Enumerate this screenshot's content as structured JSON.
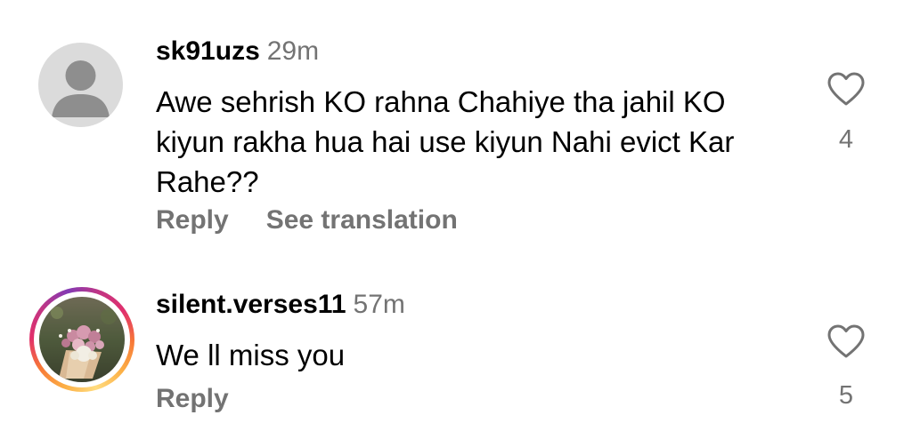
{
  "comments": [
    {
      "username": "sk91uzs",
      "timestamp": "29m",
      "text": "Awe sehrish KO rahna Chahiye tha jahil KO kiyun rakha hua hai use kiyun Nahi evict Kar Rahe??",
      "reply_label": "Reply",
      "translate_label": "See translation",
      "like_count": "4",
      "avatar": "default-avatar-icon",
      "liked": false
    },
    {
      "username": "silent.verses11",
      "timestamp": "57m",
      "text": "We ll miss you",
      "reply_label": "Reply",
      "like_count": "5",
      "avatar": "flower-bouquet-photo",
      "has_story_ring": true,
      "liked": false
    }
  ],
  "colors": {
    "text_primary": "#000000",
    "text_secondary": "#737373",
    "avatar_placeholder_bg": "#dbdbdb",
    "avatar_placeholder_fg": "#8e8e8e"
  }
}
